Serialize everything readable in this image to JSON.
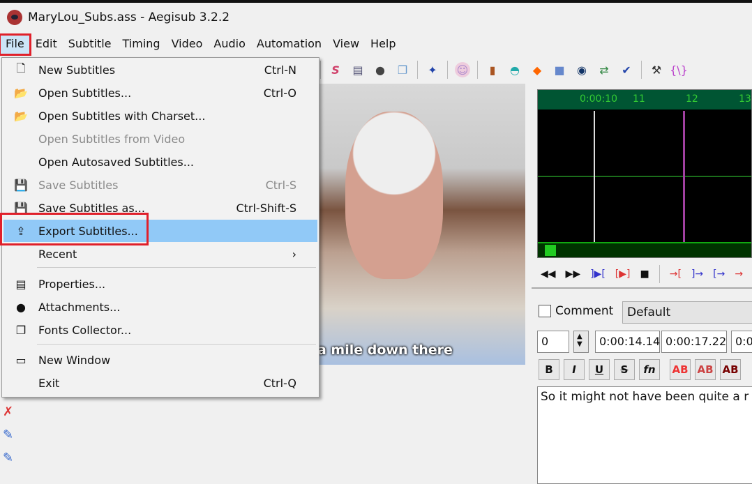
{
  "window": {
    "title": "MaryLou_Subs.ass - Aegisub 3.2.2"
  },
  "menubar": [
    "File",
    "Edit",
    "Subtitle",
    "Timing",
    "Video",
    "Audio",
    "Automation",
    "View",
    "Help"
  ],
  "file_menu": [
    {
      "label": "New Subtitles",
      "shortcut": "Ctrl-N",
      "icon": "new-file-icon",
      "disabled": false
    },
    {
      "label": "Open Subtitles...",
      "shortcut": "Ctrl-O",
      "icon": "open-folder-icon",
      "disabled": false
    },
    {
      "label": "Open Subtitles with Charset...",
      "shortcut": "",
      "icon": "open-charset-icon",
      "disabled": false
    },
    {
      "label": "Open Subtitles from Video",
      "shortcut": "",
      "icon": "",
      "disabled": true
    },
    {
      "label": "Open Autosaved Subtitles...",
      "shortcut": "",
      "icon": "",
      "disabled": false
    },
    {
      "label": "Save Subtitles",
      "shortcut": "Ctrl-S",
      "icon": "save-icon",
      "disabled": true
    },
    {
      "label": "Save Subtitles as...",
      "shortcut": "Ctrl-Shift-S",
      "icon": "save-as-icon",
      "disabled": false
    },
    {
      "label": "Export Subtitles...",
      "shortcut": "",
      "icon": "export-icon",
      "disabled": false,
      "highlighted": true
    },
    {
      "label": "Recent",
      "shortcut": "›",
      "icon": "",
      "disabled": false
    },
    {
      "label": "Properties...",
      "shortcut": "",
      "icon": "properties-icon",
      "disabled": false
    },
    {
      "label": "Attachments...",
      "shortcut": "",
      "icon": "attachment-icon",
      "disabled": false
    },
    {
      "label": "Fonts Collector...",
      "shortcut": "",
      "icon": "fonts-collector-icon",
      "disabled": false
    },
    {
      "label": "New Window",
      "shortcut": "",
      "icon": "new-window-icon",
      "disabled": false
    },
    {
      "label": "Exit",
      "shortcut": "Ctrl-Q",
      "icon": "",
      "disabled": false
    }
  ],
  "video": {
    "subtitle": "a mile down there"
  },
  "audio": {
    "ticks": [
      "0:00:10",
      "11",
      "12",
      "13"
    ]
  },
  "editor": {
    "comment_label": "Comment",
    "style": "Default",
    "layer": "0",
    "start": "0:00:14.14",
    "end": "0:00:17.22",
    "duration": "0:0",
    "text": "So it might not have been quite a r",
    "format_buttons": [
      "B",
      "I",
      "U",
      "S",
      "fn",
      "AB",
      "AB",
      "AB"
    ]
  },
  "colors": {
    "highlight": "#91c9f7",
    "annotation": "#e0202a",
    "waveform": "#1b6e1b"
  }
}
